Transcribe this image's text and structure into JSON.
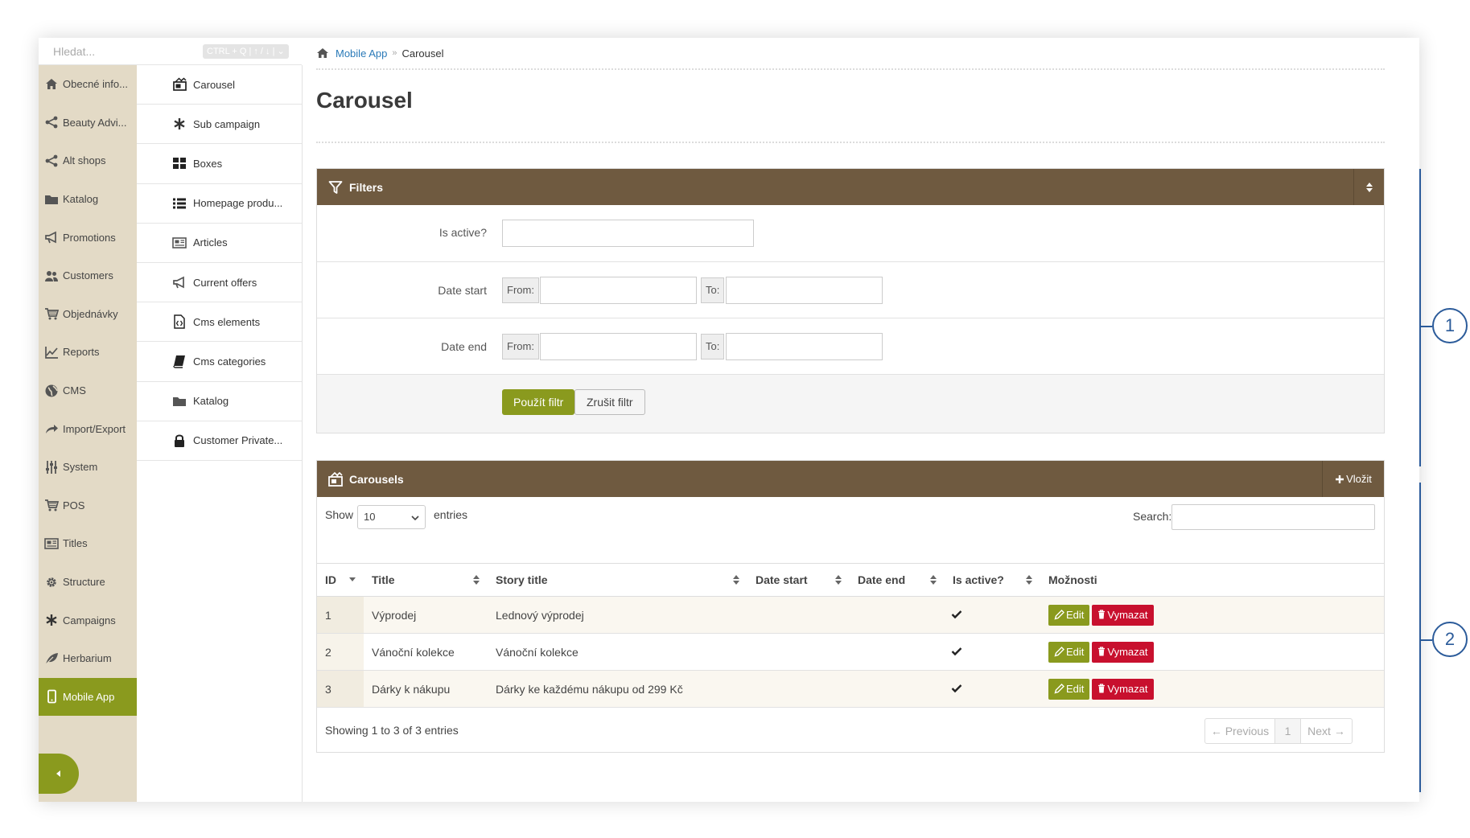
{
  "search": {
    "placeholder": "Hledat...",
    "hint": "CTRL + Q | ↑ / ↓ | ⌄"
  },
  "sidebar": {
    "items": [
      {
        "label": "Obecné info...",
        "icon": "home-icon"
      },
      {
        "label": "Beauty Advi...",
        "icon": "share-icon"
      },
      {
        "label": "Alt shops",
        "icon": "share-icon"
      },
      {
        "label": "Katalog",
        "icon": "folder-icon"
      },
      {
        "label": "Promotions",
        "icon": "megaphone-icon"
      },
      {
        "label": "Customers",
        "icon": "users-icon"
      },
      {
        "label": "Objednávky",
        "icon": "cart-icon"
      },
      {
        "label": "Reports",
        "icon": "chart-icon"
      },
      {
        "label": "CMS",
        "icon": "globe-icon"
      },
      {
        "label": "Import/Export",
        "icon": "share-arrow-icon"
      },
      {
        "label": "System",
        "icon": "sliders-icon"
      },
      {
        "label": "POS",
        "icon": "cart-icon"
      },
      {
        "label": "Titles",
        "icon": "newspaper-icon"
      },
      {
        "label": "Structure",
        "icon": "cog-icon"
      },
      {
        "label": "Campaigns",
        "icon": "asterisk-icon"
      },
      {
        "label": "Herbarium",
        "icon": "leaf-icon"
      },
      {
        "label": "Mobile App",
        "icon": "mobile-icon",
        "active": true
      }
    ]
  },
  "submenu": {
    "items": [
      {
        "label": "Carousel",
        "icon": "carousel-icon"
      },
      {
        "label": "Sub campaign",
        "icon": "asterisk-icon"
      },
      {
        "label": "Boxes",
        "icon": "grid-icon"
      },
      {
        "label": "Homepage produ...",
        "icon": "list-icon"
      },
      {
        "label": "Articles",
        "icon": "newspaper-icon"
      },
      {
        "label": "Current offers",
        "icon": "megaphone-icon"
      },
      {
        "label": "Cms elements",
        "icon": "file-code-icon"
      },
      {
        "label": "Cms categories",
        "icon": "book-icon"
      },
      {
        "label": "Katalog",
        "icon": "folder-icon"
      },
      {
        "label": "Customer Private...",
        "icon": "lock-icon"
      }
    ]
  },
  "breadcrumb": {
    "home_icon": "home-icon",
    "parent": "Mobile App",
    "separator": "»",
    "current": "Carousel"
  },
  "page": {
    "title": "Carousel"
  },
  "filters": {
    "title": "Filters",
    "is_active_label": "Is active?",
    "date_start_label": "Date start",
    "date_end_label": "Date end",
    "from_label": "From:",
    "to_label": "To:",
    "apply_label": "Použít filtr",
    "cancel_label": "Zrušit filtr"
  },
  "carousels": {
    "title": "Carousels",
    "add_label": "Vložit",
    "show_label": "Show",
    "entries_label": "entries",
    "page_size": "10",
    "search_label": "Search:",
    "columns": [
      "ID",
      "Title",
      "Story title",
      "Date start",
      "Date end",
      "Is active?",
      "Možnosti"
    ],
    "rows": [
      {
        "id": "1",
        "title": "Výprodej",
        "story_title": "Lednový výprodej",
        "date_start": "",
        "date_end": "",
        "active": true
      },
      {
        "id": "2",
        "title": "Vánoční kolekce",
        "story_title": "Vánoční kolekce",
        "date_start": "",
        "date_end": "",
        "active": true
      },
      {
        "id": "3",
        "title": "Dárky k nákupu",
        "story_title": "Dárky ke každému nákupu od 299 Kč",
        "date_start": "",
        "date_end": "",
        "active": true
      }
    ],
    "edit_label": "Edit",
    "delete_label": "Vymazat",
    "info": "Showing 1 to 3 of 3 entries",
    "prev_label": "← Previous",
    "page_number": "1",
    "next_label": "Next →"
  },
  "callouts": [
    "1",
    "2"
  ],
  "colors": {
    "accent": "#8a9a1e",
    "panel_header": "#6f5a40",
    "danger": "#c8102e",
    "sidebar": "#e3dac6",
    "link": "#2a7ab8",
    "callout": "#2b5b9a"
  }
}
